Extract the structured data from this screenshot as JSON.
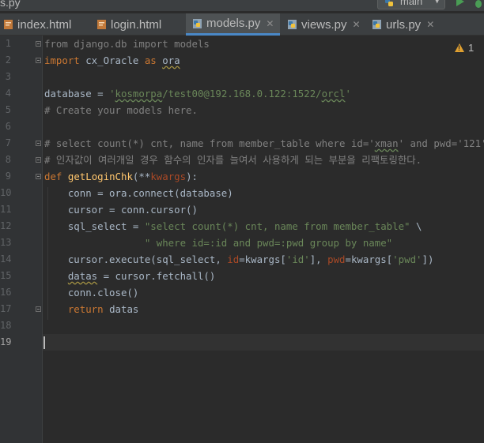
{
  "window": {
    "title_fragment": "s.py",
    "run_config": "main"
  },
  "tabs": [
    {
      "label": "index.html",
      "icon": "html-file-icon"
    },
    {
      "label": "login.html",
      "icon": "html-file-icon"
    },
    {
      "label": "models.py",
      "icon": "python-file-icon",
      "active": true
    },
    {
      "label": "views.py",
      "icon": "python-file-icon"
    },
    {
      "label": "urls.py",
      "icon": "python-file-icon"
    }
  ],
  "inspection": {
    "warnings": "1"
  },
  "colors": {
    "keyword": "#cc7832",
    "string": "#6a8759",
    "comment": "#808080",
    "function": "#ffc66d",
    "param": "#aa4926",
    "text": "#a9b7c6",
    "background": "#2b2b2b"
  },
  "editor": {
    "line_numbers": [
      "1",
      "2",
      "3",
      "4",
      "5",
      "6",
      "7",
      "8",
      "9",
      "10",
      "11",
      "12",
      "13",
      "14",
      "15",
      "16",
      "17",
      "18",
      "19"
    ],
    "current_line": "19",
    "lines": {
      "l1": {
        "t1": "from django.db import models"
      },
      "l2": {
        "kw1": "import",
        "t1": " cx_Oracle ",
        "kw2": "as",
        "t2": " ",
        "t3": "ora"
      },
      "l4": {
        "t1": "database = ",
        "s1": "'",
        "s2": "kosmorpa",
        "s3": "/test00@192.168.0.122:1522/",
        "s4": "orcl",
        "s5": "'"
      },
      "l5": {
        "c1": "# Create your models here."
      },
      "l7": {
        "c1": "# select count(*) cnt, name from member_table where id='",
        "c2": "xman",
        "c3": "' and pwd='121'"
      },
      "l8": {
        "c1": "# 인자값이 여러개일 경우 함수의 인자를 늘여서 사용하게 되는 부분을 리팩토링한다."
      },
      "l9": {
        "kw1": "def",
        "t1": " ",
        "fn": "getLoginChk",
        "t2": "(**",
        "pn": "kwargs",
        "t3": "):"
      },
      "l10": {
        "t1": "    conn = ora.connect(database)"
      },
      "l11": {
        "t1": "    cursor = conn.cursor()"
      },
      "l12": {
        "t1": "    sql_select = ",
        "s1": "\"select count(*) cnt, name from member_table\"",
        "t2": " \\"
      },
      "l13": {
        "t1": "                 ",
        "s1": "\" where id=:id and pwd=:pwd group by name\""
      },
      "l14": {
        "t1": "    cursor.execute(sql_select, ",
        "pn1": "id",
        "t2": "=kwargs[",
        "s1": "'id'",
        "t3": "], ",
        "pn2": "pwd",
        "t4": "=kwargs[",
        "s2": "'pwd'",
        "t5": "])"
      },
      "l15": {
        "t1": "    ",
        "t2": "datas",
        "t3": " = cursor.fetchall()"
      },
      "l16": {
        "t1": "    conn.close()"
      },
      "l17": {
        "t1": "    ",
        "kw1": "return",
        "t2": " datas"
      }
    }
  }
}
